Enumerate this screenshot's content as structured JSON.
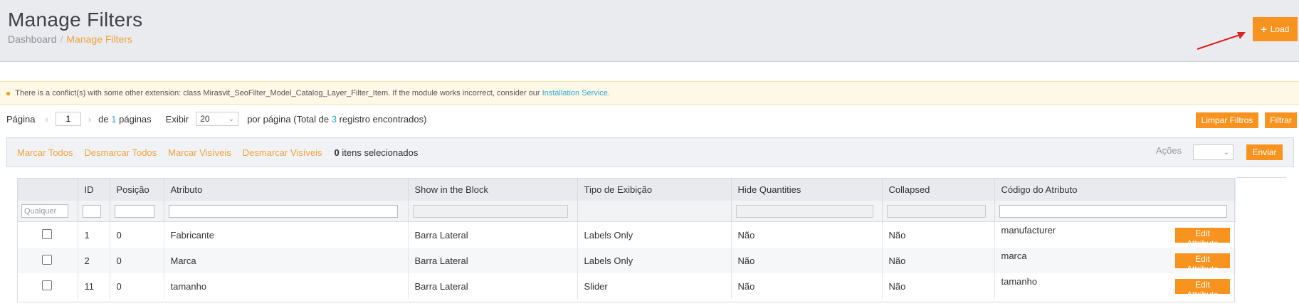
{
  "header": {
    "title": "Manage Filters",
    "breadcrumb": {
      "root": "Dashboard",
      "separator": "/",
      "current": "Manage Filters"
    },
    "load_button": {
      "icon": "plus-icon",
      "label": "Load"
    }
  },
  "notice": {
    "icon": "lightbulb-icon",
    "text": "There is a conflict(s) with some other extension: class Mirasvit_SeoFilter_Model_Catalog_Layer_Filter_Item. If the module works incorrect, consider our",
    "link": "Installation Service."
  },
  "pager": {
    "page_label": "Página",
    "current_page": "1",
    "of_prefix": "de",
    "total_pages": "1",
    "pages_suffix": "páginas",
    "show_label": "Exibir",
    "per_page": "20",
    "per_page_prefix": "por página (Total de",
    "total_records": "3",
    "per_page_suffix": "registro encontrados)"
  },
  "actions": {
    "clear_filters": "Limpar Filtros",
    "filter": "Filtrar"
  },
  "massaction": {
    "select_all": "Marcar Todos",
    "unselect_all": "Desmarcar Todos",
    "select_visible": "Marcar Visíveis",
    "unselect_visible": "Desmarcar Visíveis",
    "selected_count": "0",
    "selected_label": "itens selecionados",
    "actions_label": "Ações",
    "submit": "Enviar"
  },
  "grid": {
    "columns": [
      "",
      "ID",
      "Posição",
      "Atributo",
      "Show in the Block",
      "Tipo de Exibição",
      "Hide Quantities",
      "Collapsed",
      "Código do Atributo"
    ],
    "filter_any": "Qualquer",
    "edit_label": "Edit Attribute",
    "rows": [
      {
        "id": "1",
        "position": "0",
        "attribute": "Fabricante",
        "show_in_block": "Barra Lateral",
        "display_type": "Labels Only",
        "hide_quantities": "Não",
        "collapsed": "Não",
        "code": "manufacturer"
      },
      {
        "id": "2",
        "position": "0",
        "attribute": "Marca",
        "show_in_block": "Barra Lateral",
        "display_type": "Labels Only",
        "hide_quantities": "Não",
        "collapsed": "Não",
        "code": "marca"
      },
      {
        "id": "11",
        "position": "0",
        "attribute": "tamanho",
        "show_in_block": "Barra Lateral",
        "display_type": "Slider",
        "hide_quantities": "Não",
        "collapsed": "Não",
        "code": "tamanho"
      }
    ]
  },
  "colors": {
    "accent": "#f7931e",
    "link": "#2ea9d6",
    "annotation_arrow": "#e02020"
  }
}
